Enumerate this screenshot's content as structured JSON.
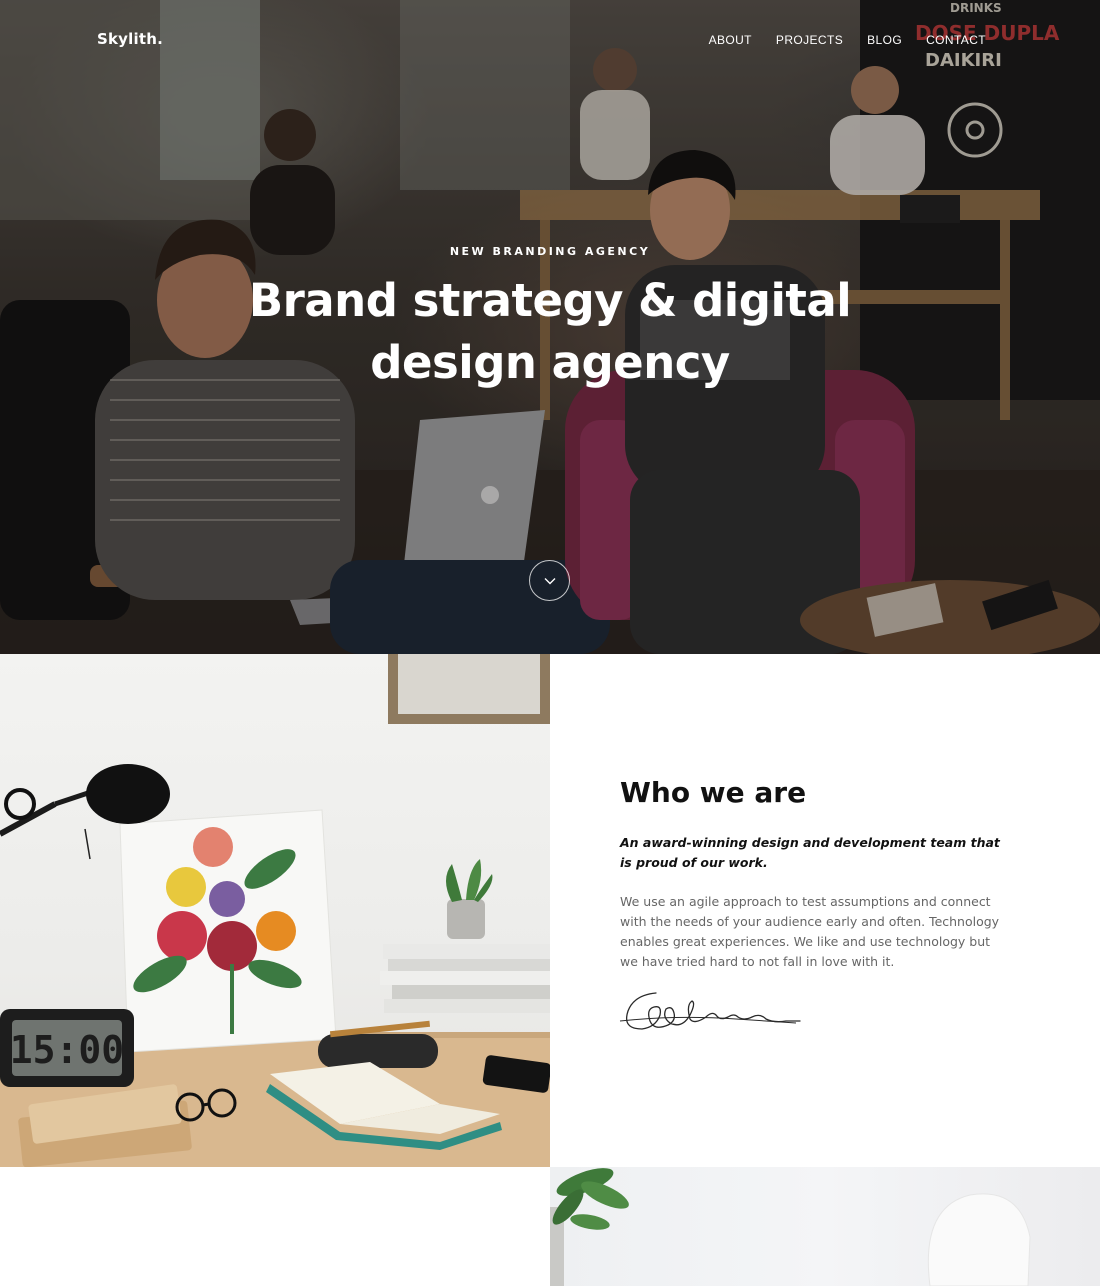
{
  "header": {
    "logo": "Skylith.",
    "nav": [
      {
        "label": "ABOUT"
      },
      {
        "label": "PROJECTS"
      },
      {
        "label": "BLOG"
      },
      {
        "label": "CONTACT"
      }
    ]
  },
  "hero": {
    "kicker": "NEW BRANDING AGENCY",
    "title": "Brand strategy & digital design agency",
    "scroll_icon": "chevron-down-icon",
    "chalkboard_lines": [
      "DRINKS",
      "DOSE DUPLA",
      "DAIKIRI"
    ]
  },
  "about": {
    "title": "Who we are",
    "lead": "An award-winning design and development team that is proud of our work.",
    "body": "We use an agile approach to test assumptions and connect with the needs of your audience early and often. Technology enables great experiences. We like and use technology but we have tried hard to not fall in love with it.",
    "clock_time": "15:00"
  },
  "colors": {
    "text_dark": "#111111",
    "text_muted": "#666666",
    "hero_text": "#ffffff"
  }
}
